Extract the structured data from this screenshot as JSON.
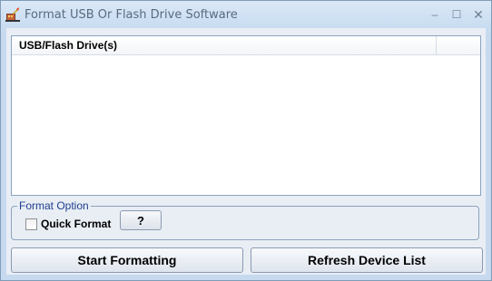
{
  "window": {
    "title": "Format USB Or Flash Drive Software",
    "app_icon": "usb-drive-app-icon",
    "controls": {
      "minimize": "–",
      "maximize": "☐",
      "close": "✕"
    }
  },
  "device_list": {
    "columns": [
      "USB/Flash Drive(s)"
    ],
    "rows": []
  },
  "format_option": {
    "title": "Format Option",
    "quick_format_label": "Quick Format",
    "quick_format_checked": false,
    "help_label": "?"
  },
  "actions": {
    "start_label": "Start Formatting",
    "refresh_label": "Refresh Device List"
  }
}
